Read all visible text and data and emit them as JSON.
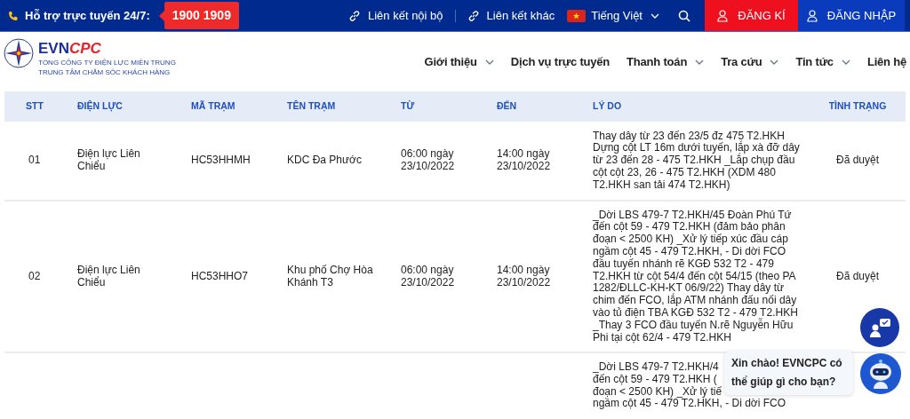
{
  "top_bar": {
    "support_label": "Hỗ trợ trực tuyến 24/7:",
    "hotline": "1900 1909",
    "links": [
      "Liên kết nội bộ",
      "Liên kết khác"
    ],
    "language": "Tiếng Việt",
    "register": "ĐĂNG KÍ",
    "login": "ĐĂNG NHẬP"
  },
  "header": {
    "logo": "EVN",
    "logo_accent": "CPC",
    "subtitle": [
      "TỔNG CÔNG TY ĐIỆN LỰC MIỀN TRUNG",
      "TRUNG TÂM CHĂM SÓC KHÁCH HÀNG"
    ],
    "nav": [
      {
        "label": "Giới thiệu",
        "dropdown": true
      },
      {
        "label": "Dịch vụ trực tuyến",
        "dropdown": false
      },
      {
        "label": "Thanh toán",
        "dropdown": true
      },
      {
        "label": "Tra cứu",
        "dropdown": true
      },
      {
        "label": "Tin tức",
        "dropdown": true
      },
      {
        "label": "Liên hệ",
        "dropdown": false
      }
    ]
  },
  "table": {
    "columns": [
      "STT",
      "ĐIỆN LỰC",
      "MÃ TRẠM",
      "TÊN TRẠM",
      "TỪ",
      "ĐẾN",
      "LÝ DO",
      "TÌNH TRẠNG"
    ],
    "rows": [
      {
        "cells": [
          "01",
          "Điện lực Liên Chiểu",
          "HC53HHMH",
          "KDC Đa Phước",
          "06:00 ngày 23/10/2022",
          "14:00 ngày 23/10/2022",
          "Thay dây từ 23 đến 23/5 đz 475 T2.HKH Dựng cột LT 16m dưới tuyến, lắp xà đỡ dây từ 23 đến 28 - 475 T2.HKH _Lắp chụp đầu cột cột 23, 26 - 475 T2.HKH (XDM 480 T2.HKH san tải 474 T2.HKH)",
          "Đã duyệt"
        ]
      },
      {
        "cells": [
          "02",
          "Điện lực Liên Chiểu",
          "HC53HHO7",
          "Khu phố Chợ Hòa Khánh T3",
          "06:00 ngày 23/10/2022",
          "14:00 ngày 23/10/2022",
          "_Dời LBS 479-7 T2.HKH/45 Đoàn Phú Tứ đến cột 59 - 479 T2.HKH (đảm bảo phân đoạn < 2500 KH) _Xử lý tiếp xúc đầu cáp ngầm cột 45 - 479 T2.HKH, - Di dời FCO đầu tuyến nhánh rẽ KGĐ 532 T2 - 479 T2.HKH từ cột 54/4 đến cột 54/15 (theo PA 1282/ĐLLC-KH-KT 06/9/22) Thay dây từ chim đến FCO, lắp ATM nhánh đấu nối dây vào tủ điện TBA KGĐ 532 T2 - 479 T2.HKH _Thay 3 FCO đầu tuyến N.rẽ Nguyễn Hữu Phi tại cột 62/4 - 479 T2.HKH",
          "Đã duyệt"
        ]
      }
    ],
    "partial_row_reason_lines": [
      "_Dời LBS 479-7 T2.HKH/4",
      "đến cột 59 - 479 T2.HKH (",
      "đoạn < 2500 KH) _Xử lý tiế",
      "ngầm cột 45 - 479 T2.HKH, - Di dời FCO"
    ]
  },
  "chat": {
    "greeting": "Xin chào! EVNCPC có thể giúp gì cho bạn?"
  }
}
